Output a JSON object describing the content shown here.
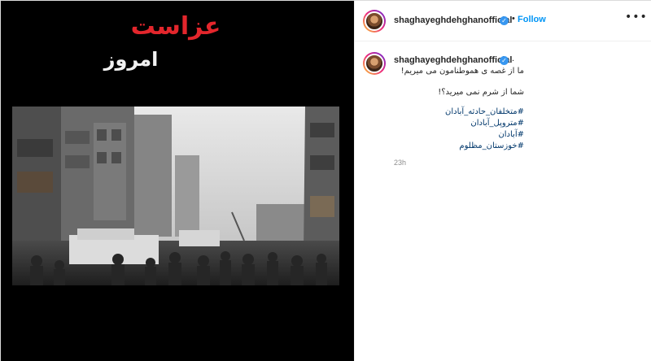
{
  "media": {
    "overlay_title": "عزاست",
    "overlay_subtitle": "امروز"
  },
  "post": {
    "username": "shaghayeghdehghanofficial",
    "verified_glyph": "✓",
    "dot": "•",
    "follow_label": "Follow",
    "more_label": "•••"
  },
  "caption": {
    "username": "shaghayeghdehghanofficial",
    "dot": ".",
    "lines": [
      "ما از غصه ی هموطنامون می میریم!",
      "شما از شرم نمی میرید؟!",
      "#متخلفان_حادثه_آبادان",
      "#متروپل_آبادان",
      "#آبادان",
      "#خوزستان_مظلوم"
    ],
    "timestamp": "23h"
  },
  "colors": {
    "accent": "#0095f6",
    "overlay_red": "#e3262c",
    "hashtag": "#00376b"
  },
  "icons": {
    "verified": "verified-badge-icon",
    "more": "more-options-icon"
  }
}
